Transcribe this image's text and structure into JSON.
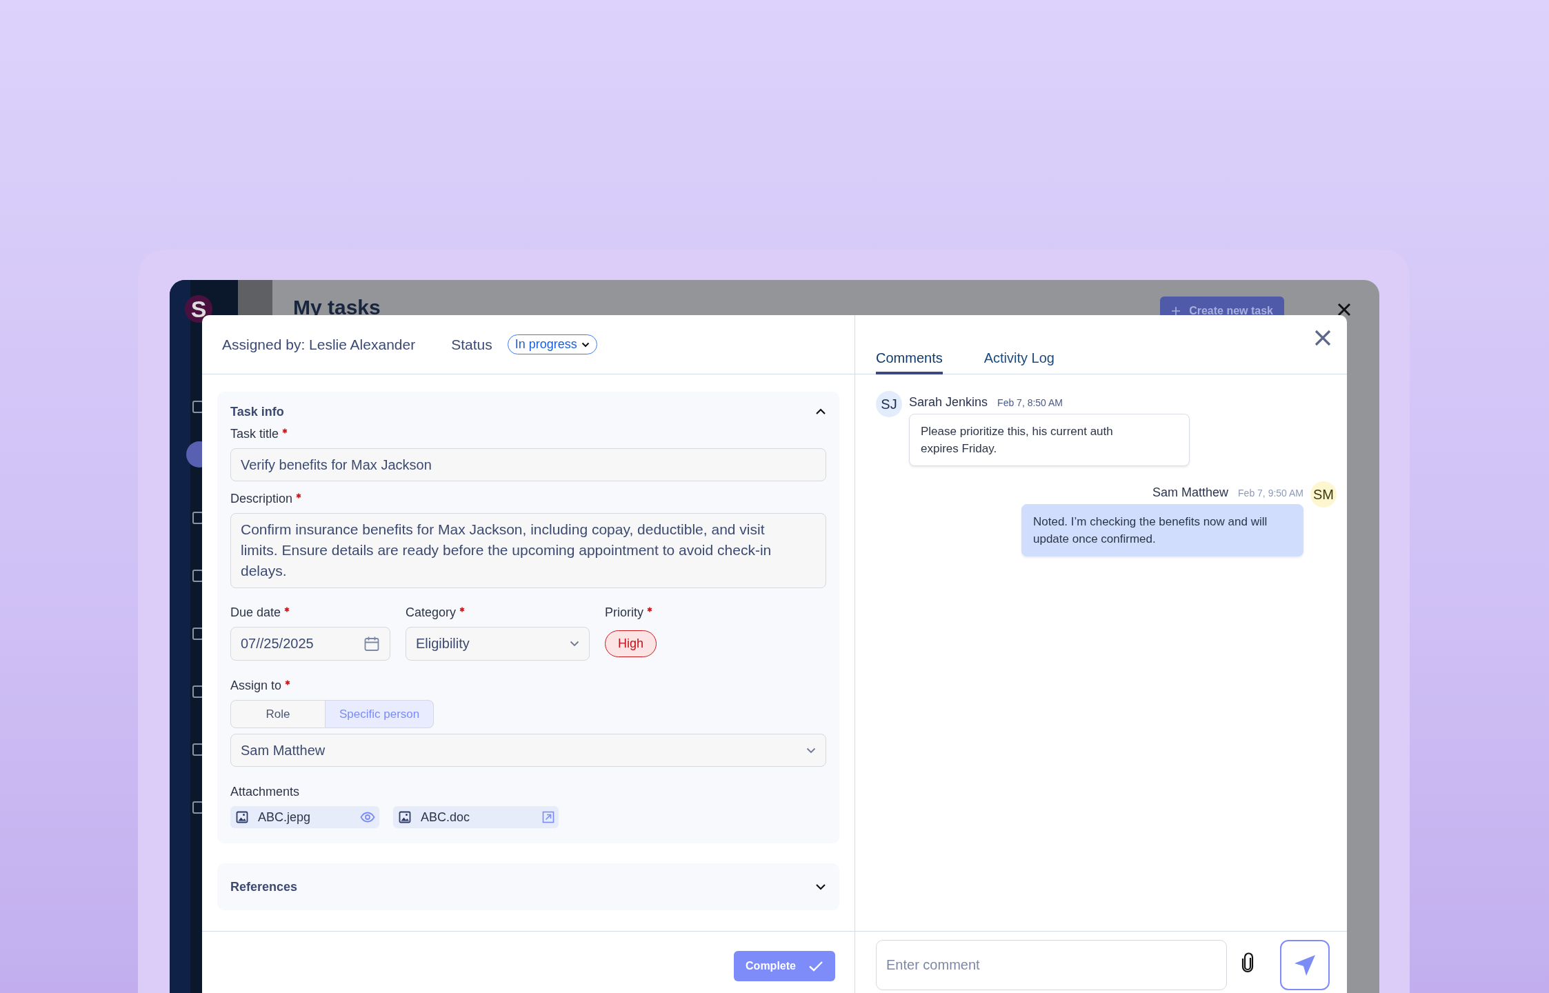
{
  "background_app": {
    "logo": "S",
    "title": "My tasks",
    "create_button": "Create new task"
  },
  "task_panel": {
    "assigned_by": "Assigned by: Leslie Alexander",
    "status_label": "Status",
    "status": "In progress",
    "task_info": {
      "title": "Task info",
      "expanded": true,
      "task_title": {
        "label": "Task title",
        "required": true,
        "value": "Verify benefits for Max Jackson"
      },
      "description": {
        "label": "Description",
        "required": true,
        "value": "Confirm insurance benefits for Max Jackson, including copay, deductible, and visit limits. Ensure details are ready before the upcoming appointment to avoid check-in delays."
      },
      "due_date": {
        "label": "Due date",
        "required": true,
        "value": "07//25/2025"
      },
      "category": {
        "label": "Category",
        "required": true,
        "value": "Eligibility"
      },
      "priority": {
        "label": "Priority",
        "required": true,
        "value": "High"
      },
      "assign_to": {
        "label": "Assign to",
        "required": true,
        "options": [
          {
            "label": "Role",
            "selected": false
          },
          {
            "label": "Specific person",
            "selected": true
          }
        ],
        "value": "Sam Matthew"
      },
      "attachments": {
        "label": "Attachments",
        "files": [
          {
            "name": "ABC.jepg",
            "kind": "preview"
          },
          {
            "name": "ABC.doc",
            "kind": "open"
          }
        ]
      }
    },
    "references": {
      "title": "References",
      "expanded": false
    },
    "complete_button": "Complete"
  },
  "comments_panel": {
    "tabs": [
      {
        "label": "Comments",
        "selected": true
      },
      {
        "label": "Activity Log",
        "selected": false
      }
    ],
    "comments": [
      {
        "initials": "SJ",
        "color": "#e3ecfb",
        "author": "Sarah Jenkins",
        "time": "Feb 7, 8:50 AM",
        "text": "Please prioritize this, his current auth expires Friday.",
        "own": false
      },
      {
        "initials": "SM",
        "color": "#fdf6cf",
        "author": "Sam Matthew",
        "time": "Feb 7, 9:50 AM",
        "text": "Noted. I’m checking the benefits now and will update once confirmed.",
        "own": true
      }
    ],
    "comment_input": {
      "placeholder": "Enter comment"
    }
  }
}
